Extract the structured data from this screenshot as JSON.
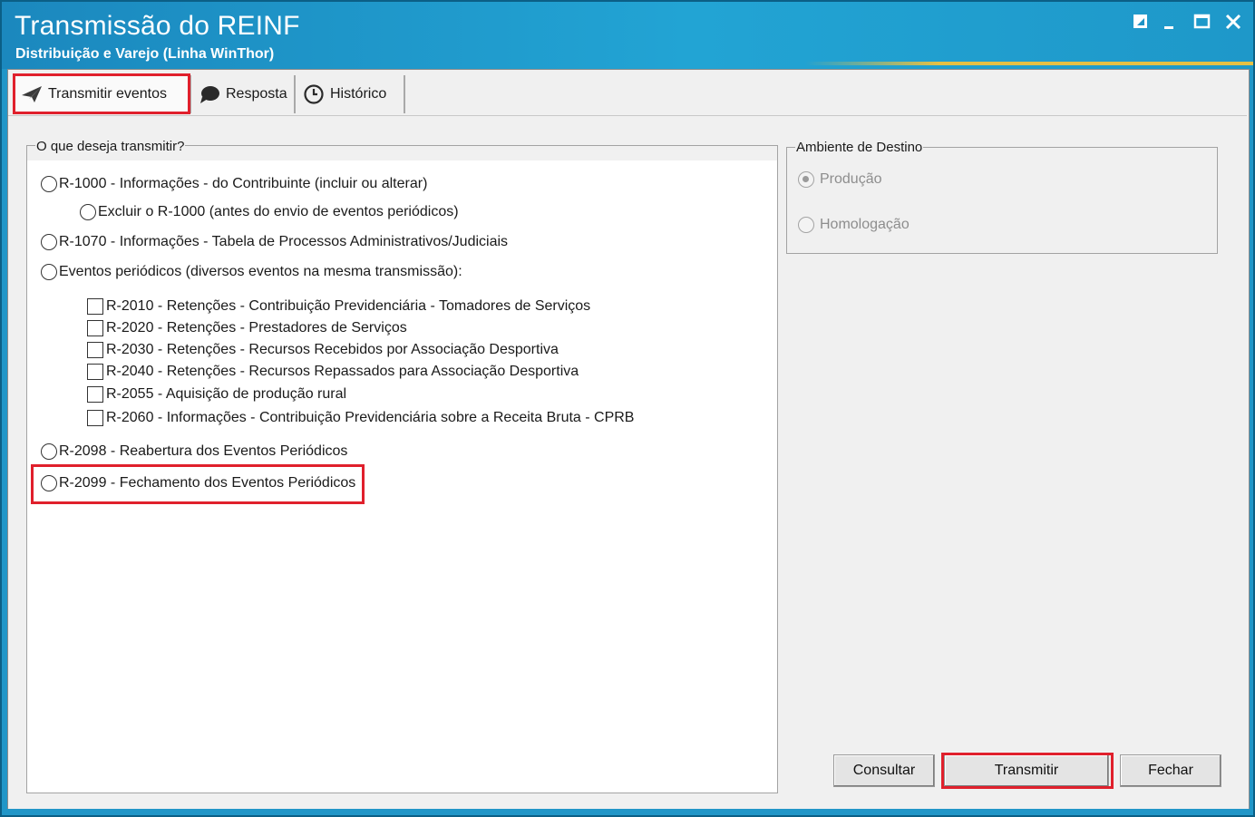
{
  "window": {
    "title": "Transmissão do REINF",
    "subtitle": "Distribuição e Varejo (Linha WinThor)",
    "controls": [
      "restore-icon",
      "minimize-icon",
      "maximize-icon",
      "close-icon"
    ]
  },
  "tabs": [
    {
      "label": "Transmitir eventos",
      "icon": "send-icon",
      "active": true,
      "highlighted": true
    },
    {
      "label": "Resposta",
      "icon": "speech-bubble-icon",
      "active": false
    },
    {
      "label": "Histórico",
      "icon": "clock-icon",
      "active": false
    }
  ],
  "events_group": {
    "legend": "O que deseja transmitir?",
    "options": [
      {
        "label": "R-1000 - Informações - do Contribuinte (incluir ou alterar)",
        "checked": false
      },
      {
        "label": "Excluir o R-1000 (antes do envio de eventos periódicos)",
        "checked": false
      },
      {
        "label": "R-1070 - Informações - Tabela de Processos Administrativos/Judiciais",
        "checked": false
      },
      {
        "label": "Eventos periódicos (diversos eventos na mesma transmissão):",
        "checked": false
      },
      {
        "label": "R-2098 - Reabertura dos Eventos Periódicos",
        "checked": false
      },
      {
        "label": "R-2099 - Fechamento dos Eventos Periódicos",
        "checked": false,
        "highlighted": true
      }
    ],
    "periodic_events": [
      {
        "label": "R-2010 - Retenções - Contribuição Previdenciária - Tomadores de Serviços",
        "checked": false
      },
      {
        "label": "R-2020 - Retenções - Prestadores de Serviços",
        "checked": false
      },
      {
        "label": "R-2030 - Retenções - Recursos Recebidos por Associação Desportiva",
        "checked": false
      },
      {
        "label": "R-2040 - Retenções - Recursos Repassados para Associação Desportiva",
        "checked": false
      },
      {
        "label": "R-2055 - Aquisição de produção rural",
        "checked": false
      },
      {
        "label": "R-2060 - Informações - Contribuição Previdenciária sobre a Receita Bruta - CPRB",
        "checked": false
      }
    ]
  },
  "environment_group": {
    "legend": "Ambiente de Destino",
    "options": [
      {
        "label": "Produção",
        "checked": true,
        "enabled": false
      },
      {
        "label": "Homologação",
        "checked": false,
        "enabled": false
      }
    ]
  },
  "buttons": {
    "consultar": "Consultar",
    "transmitir": "Transmitir",
    "fechar": "Fechar"
  },
  "colors": {
    "titlebar": "#1b88be",
    "highlight": "#e0202c",
    "panel": "#f0f0f0"
  }
}
